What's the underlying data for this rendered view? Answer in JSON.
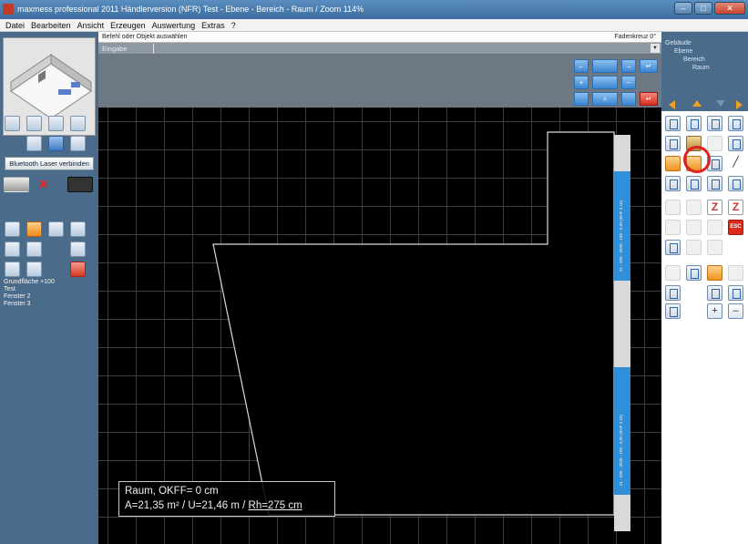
{
  "window": {
    "title": "maxmess professional 2011 Händlerversion (NFR) Test - Ebene - Bereich - Raum / Zoom 114%",
    "buttons": {
      "minimize": "–",
      "maximize": "□",
      "close": "✕"
    }
  },
  "menu": [
    "Datei",
    "Bearbeiten",
    "Ansicht",
    "Erzeugen",
    "Auswertung",
    "Extras",
    "?"
  ],
  "command": {
    "prompt": "Befehl oder Objekt auswählen",
    "crosshair": "Fadenkreuz 0°",
    "input_label": "Eingabe",
    "dropdown_glyph": "▼"
  },
  "nav": {
    "left_arrow": "←",
    "right_arrow": "→",
    "enter": "↵",
    "plus": "+",
    "minus": "–",
    "zoom_icon": "⌕",
    "buttons_blank": ""
  },
  "left_panel": {
    "bluetooth_button": "Bluetooth Laser verbinden",
    "list_items": [
      "Grundfläche +100",
      "Test",
      "Fenster 2",
      "Fenster 3"
    ]
  },
  "tree": {
    "building": "Gebäude",
    "level": "Ebene",
    "area": "Bereich",
    "room": "Raum"
  },
  "right_tools": {
    "esc_label": "ESC",
    "z_label": "Z",
    "plus_label": "+",
    "minus_label": "–"
  },
  "room_info": {
    "line1": "Raum, OKFF= 0 cm",
    "line2_prefix": "A=21,35 m² / U=21,46 m / ",
    "line2_link": "Rh=275 cm"
  },
  "wall_labels": [
    "21 - 500 - 2030 - 100 - 0.50 (BHF 3.15)",
    "21 - 500 - 2030 - 100 - 0.50 (BHF 3.10)"
  ],
  "colors": {
    "accent_blue": "#3a86d2",
    "highlight_red": "#e0201c",
    "canvas_bg": "#000000",
    "panel_bg": "#4b6b8b"
  }
}
